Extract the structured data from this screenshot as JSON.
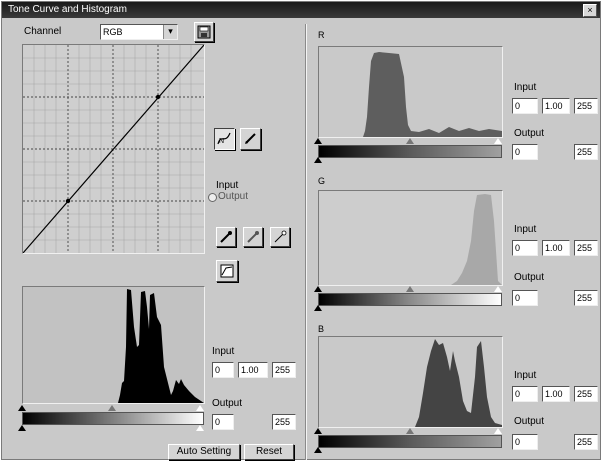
{
  "window": {
    "title": "Tone Curve and Histogram",
    "close_glyph": "×"
  },
  "channel": {
    "label": "Channel",
    "value": "RGB",
    "arrow": "▾"
  },
  "curve_tools": {
    "input_label": "Input",
    "output_label": "Output"
  },
  "main_histogram": {
    "input_label": "Input",
    "input_values": [
      "0",
      "1.00",
      "255"
    ],
    "output_label": "Output",
    "output_values": [
      "0",
      "255"
    ]
  },
  "buttons": {
    "auto_setting": "Auto Setting",
    "reset": "Reset"
  },
  "channels": [
    {
      "name": "R",
      "input_label": "Input",
      "input_values": [
        "0",
        "1.00",
        "255"
      ],
      "output_label": "Output",
      "output_values": [
        "0",
        "255"
      ]
    },
    {
      "name": "G",
      "input_label": "Input",
      "input_values": [
        "0",
        "1.00",
        "255"
      ],
      "output_label": "Output",
      "output_values": [
        "0",
        "255"
      ]
    },
    {
      "name": "B",
      "input_label": "Input",
      "input_values": [
        "0",
        "1.00",
        "255"
      ],
      "output_label": "Output",
      "output_values": [
        "0",
        "255"
      ]
    }
  ],
  "colors": {
    "window_bg": "#c9c9c9",
    "histogram_rgb": "#000000",
    "histogram_r": "#5e5e5e",
    "histogram_g": "#a8a8a8",
    "histogram_b": "#444444"
  }
}
